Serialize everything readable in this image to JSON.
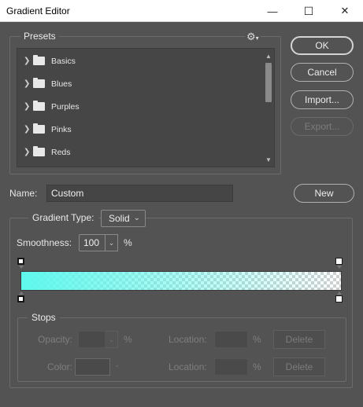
{
  "window": {
    "title": "Gradient Editor",
    "minimize_glyph": "—",
    "maximize_glyph": "☐",
    "close_glyph": "✕"
  },
  "presets": {
    "label": "Presets",
    "settings_glyph": "⚙",
    "items": [
      {
        "label": "Basics"
      },
      {
        "label": "Blues"
      },
      {
        "label": "Purples"
      },
      {
        "label": "Pinks"
      },
      {
        "label": "Reds"
      }
    ]
  },
  "buttons": {
    "ok": "OK",
    "cancel": "Cancel",
    "import": "Import...",
    "export": "Export...",
    "new": "New"
  },
  "name": {
    "label": "Name:",
    "value": "Custom"
  },
  "gradient": {
    "type_label": "Gradient Type:",
    "type_value": "Solid",
    "smoothness_label": "Smoothness:",
    "smoothness_value": "100",
    "smoothness_unit": "%",
    "start_color": "#5ef8ed"
  },
  "stops": {
    "label": "Stops",
    "opacity_label": "Opacity:",
    "opacity_unit": "%",
    "color_label": "Color:",
    "location_label": "Location:",
    "location_unit": "%",
    "delete_label": "Delete"
  }
}
